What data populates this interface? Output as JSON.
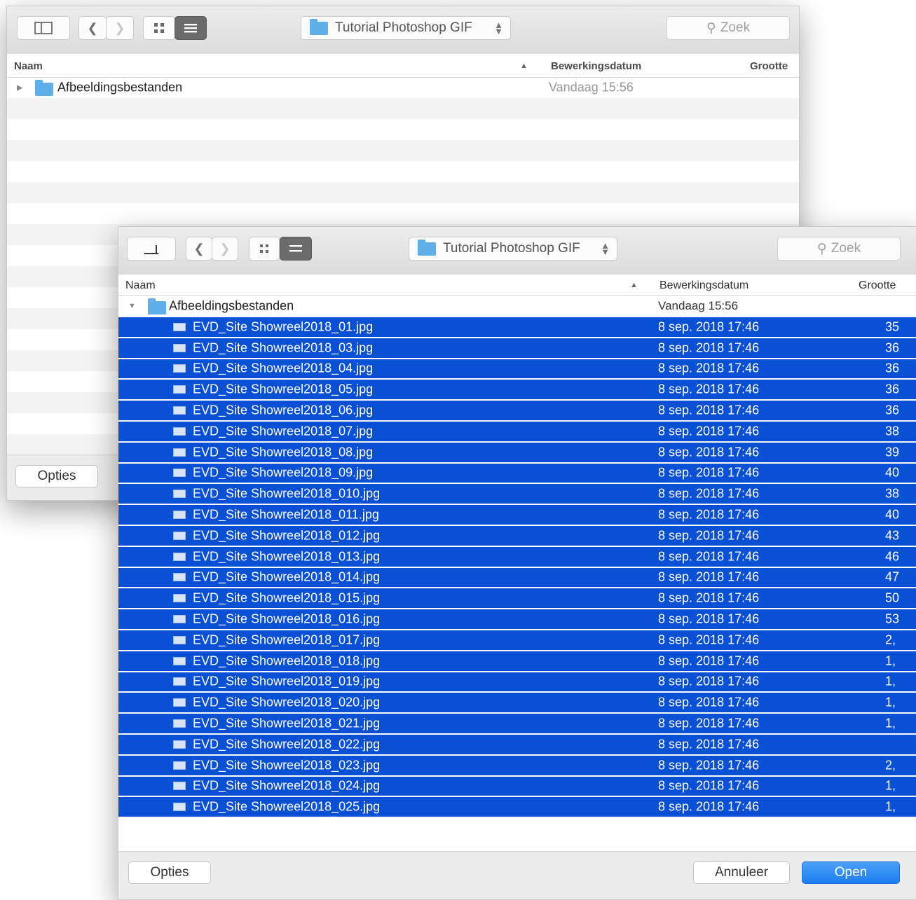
{
  "back_window": {
    "location": "Tutorial Photoshop GIF",
    "search_placeholder": "Zoek",
    "columns": {
      "name": "Naam",
      "date": "Bewerkingsdatum",
      "size": "Grootte"
    },
    "folder": {
      "name": "Afbeeldingsbestanden",
      "date": "Vandaag 15:56"
    },
    "options_button": "Opties"
  },
  "front_window": {
    "location": "Tutorial Photoshop GIF",
    "search_placeholder": "Zoek",
    "columns": {
      "name": "Naam",
      "date": "Bewerkingsdatum",
      "size": "Grootte"
    },
    "folder": {
      "name": "Afbeeldingsbestanden",
      "date": "Vandaag 15:56"
    },
    "files": [
      {
        "name": "EVD_Site Showreel2018_01.jpg",
        "date": "8 sep. 2018 17:46",
        "size": "35"
      },
      {
        "name": "EVD_Site Showreel2018_03.jpg",
        "date": "8 sep. 2018 17:46",
        "size": "36"
      },
      {
        "name": "EVD_Site Showreel2018_04.jpg",
        "date": "8 sep. 2018 17:46",
        "size": "36"
      },
      {
        "name": "EVD_Site Showreel2018_05.jpg",
        "date": "8 sep. 2018 17:46",
        "size": "36"
      },
      {
        "name": "EVD_Site Showreel2018_06.jpg",
        "date": "8 sep. 2018 17:46",
        "size": "36"
      },
      {
        "name": "EVD_Site Showreel2018_07.jpg",
        "date": "8 sep. 2018 17:46",
        "size": "38"
      },
      {
        "name": "EVD_Site Showreel2018_08.jpg",
        "date": "8 sep. 2018 17:46",
        "size": "39"
      },
      {
        "name": "EVD_Site Showreel2018_09.jpg",
        "date": "8 sep. 2018 17:46",
        "size": "40"
      },
      {
        "name": "EVD_Site Showreel2018_010.jpg",
        "date": "8 sep. 2018 17:46",
        "size": "38"
      },
      {
        "name": "EVD_Site Showreel2018_011.jpg",
        "date": "8 sep. 2018 17:46",
        "size": "40"
      },
      {
        "name": "EVD_Site Showreel2018_012.jpg",
        "date": "8 sep. 2018 17:46",
        "size": "43"
      },
      {
        "name": "EVD_Site Showreel2018_013.jpg",
        "date": "8 sep. 2018 17:46",
        "size": "46"
      },
      {
        "name": "EVD_Site Showreel2018_014.jpg",
        "date": "8 sep. 2018 17:46",
        "size": "47"
      },
      {
        "name": "EVD_Site Showreel2018_015.jpg",
        "date": "8 sep. 2018 17:46",
        "size": "50"
      },
      {
        "name": "EVD_Site Showreel2018_016.jpg",
        "date": "8 sep. 2018 17:46",
        "size": "53"
      },
      {
        "name": "EVD_Site Showreel2018_017.jpg",
        "date": "8 sep. 2018 17:46",
        "size": "2,"
      },
      {
        "name": "EVD_Site Showreel2018_018.jpg",
        "date": "8 sep. 2018 17:46",
        "size": "1,"
      },
      {
        "name": "EVD_Site Showreel2018_019.jpg",
        "date": "8 sep. 2018 17:46",
        "size": "1,"
      },
      {
        "name": "EVD_Site Showreel2018_020.jpg",
        "date": "8 sep. 2018 17:46",
        "size": "1,"
      },
      {
        "name": "EVD_Site Showreel2018_021.jpg",
        "date": "8 sep. 2018 17:46",
        "size": "1,"
      },
      {
        "name": "EVD_Site Showreel2018_022.jpg",
        "date": "8 sep. 2018 17:46",
        "size": ""
      },
      {
        "name": "EVD_Site Showreel2018_023.jpg",
        "date": "8 sep. 2018 17:46",
        "size": "2,"
      },
      {
        "name": "EVD_Site Showreel2018_024.jpg",
        "date": "8 sep. 2018 17:46",
        "size": "1,"
      },
      {
        "name": "EVD_Site Showreel2018_025.jpg",
        "date": "8 sep. 2018 17:46",
        "size": "1,"
      }
    ],
    "options_button": "Opties",
    "cancel_button": "Annuleer",
    "open_button": "Open",
    "accent_color": "#0a50d4"
  }
}
